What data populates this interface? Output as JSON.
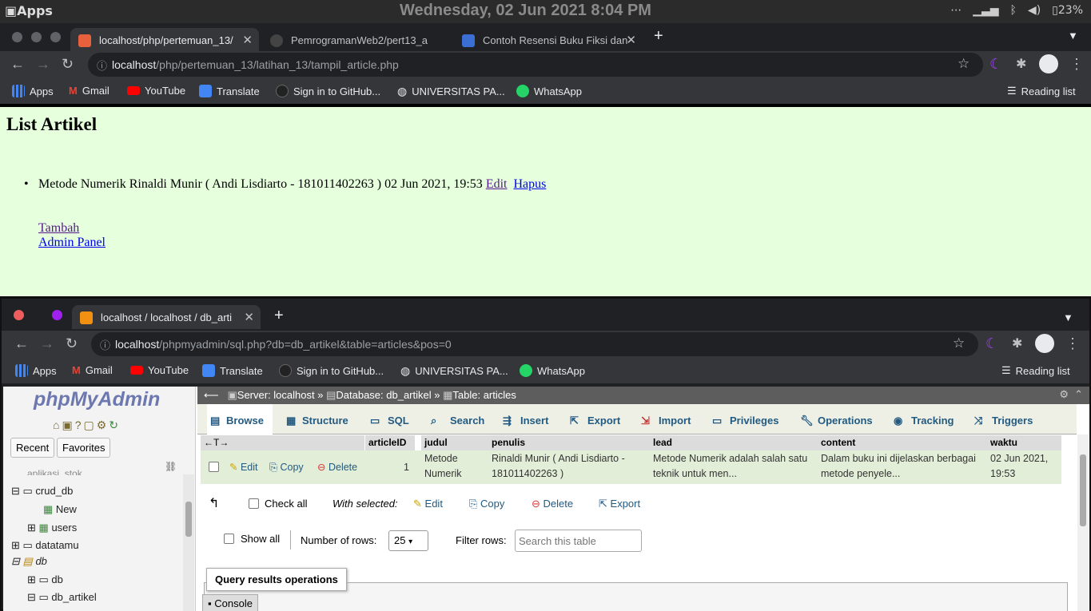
{
  "os": {
    "apps": "Apps",
    "clock": "Wednesday, 02 Jun 2021  8:04 PM",
    "battery": "23%"
  },
  "browser1": {
    "tabs": [
      {
        "label": "localhost/php/pertemuan_13/"
      },
      {
        "label": "PemrogramanWeb2/pert13_a"
      },
      {
        "label": "Contoh Resensi Buku Fiksi dan"
      }
    ],
    "url_host": "localhost",
    "url_path": "/php/pertemuan_13/latihan_13/tampil_article.php",
    "bookmarks": [
      "Apps",
      "Gmail",
      "YouTube",
      "Translate",
      "Sign in to GitHub...",
      "UNIVERSITAS PA...",
      "WhatsApp"
    ],
    "reading_list": "Reading list"
  },
  "page": {
    "title": "List Artikel",
    "article": {
      "text": "Metode Numerik  Rinaldi Munir ( Andi Lisdiarto - 181011402263 )   02 Jun 2021, 19:53 ",
      "edit": "Edit",
      "hapus": "Hapus"
    },
    "tambah": "Tambah",
    "admin": "Admin Panel"
  },
  "browser2": {
    "tab": "localhost / localhost / db_arti",
    "url_host": "localhost",
    "url_path": "/phpmyadmin/sql.php?db=db_artikel&table=articles&pos=0",
    "bookmarks": [
      "Apps",
      "Gmail",
      "YouTube",
      "Translate",
      "Sign in to GitHub...",
      "UNIVERSITAS PA...",
      "WhatsApp"
    ],
    "reading_list": "Reading list"
  },
  "pma": {
    "logo": "phpMyAdmin",
    "recent": "Recent",
    "favorites": "Favorites",
    "tree": [
      "aplikasi_stok",
      "crud_db",
      "New",
      "users",
      "datatamu",
      "db",
      "db",
      "db_artikel"
    ],
    "breadcrumb": {
      "server": "Server: localhost",
      "database": "Database: db_artikel",
      "table": "Table: articles"
    },
    "tabs": [
      "Browse",
      "Structure",
      "SQL",
      "Search",
      "Insert",
      "Export",
      "Import",
      "Privileges",
      "Operations",
      "Tracking",
      "Triggers"
    ],
    "columns": [
      "articleID",
      "judul",
      "penulis",
      "lead",
      "content",
      "waktu"
    ],
    "row": {
      "edit": "Edit",
      "copy": "Copy",
      "delete": "Delete",
      "articleID": "1",
      "judul": "Metode Numerik",
      "penulis": "Rinaldi Munir ( Andi Lisdiarto - 181011402263 )",
      "lead": "Metode Numerik adalah salah satu teknik untuk men...",
      "content": "Dalam buku ini dijelaskan berbagai metode penyele...",
      "waktu": "02 Jun 2021, 19:53"
    },
    "checkall": "Check all",
    "with_selected": "With selected:",
    "bulk": {
      "edit": "Edit",
      "copy": "Copy",
      "delete": "Delete",
      "export": "Export"
    },
    "show_all": "Show all",
    "num_rows_label": "Number of rows:",
    "num_rows": "25",
    "filter_label": "Filter rows:",
    "filter_placeholder": "Search this table",
    "query_ops": "Query results operations",
    "console": "Console"
  }
}
